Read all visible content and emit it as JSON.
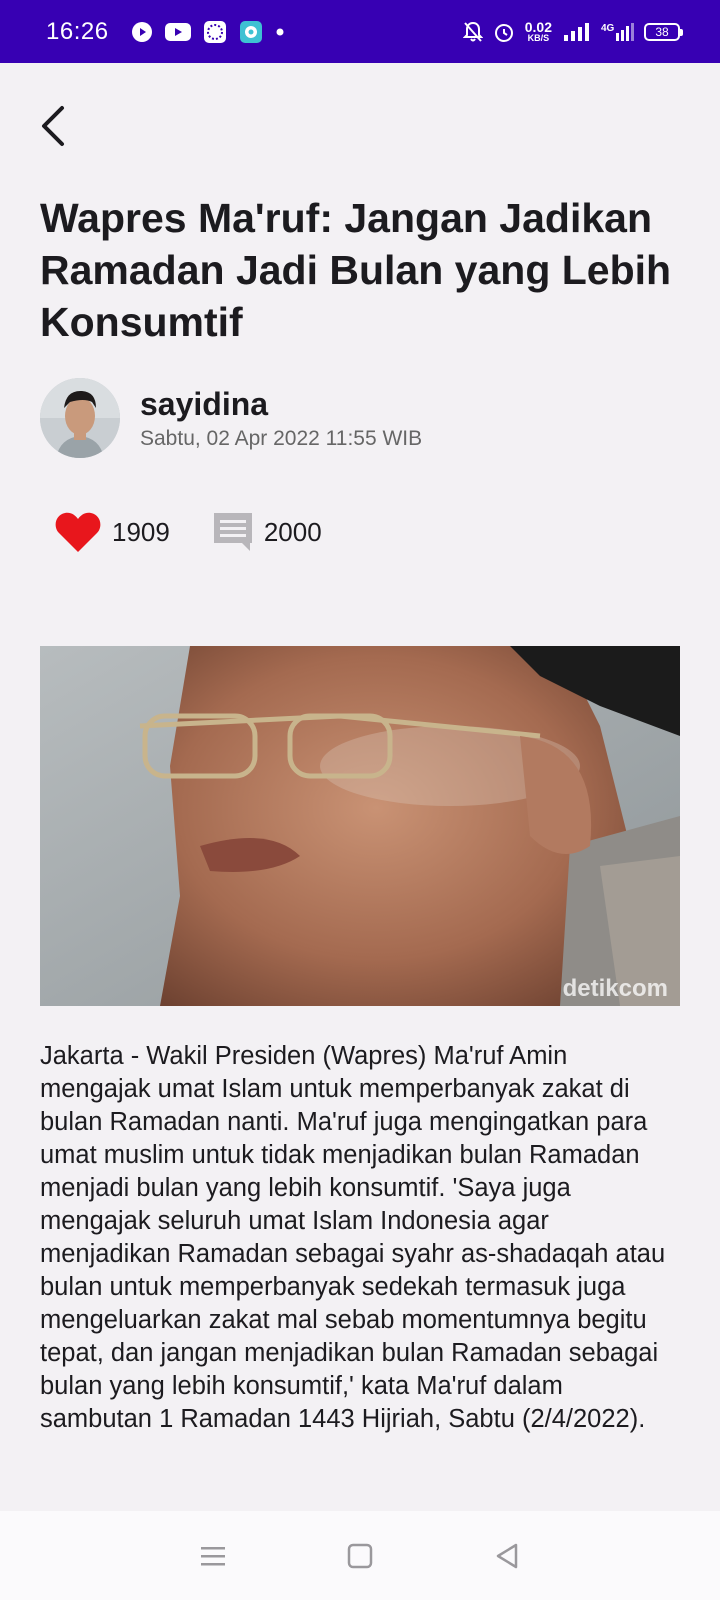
{
  "status_bar": {
    "time": "16:26",
    "net_speed_value": "0.02",
    "net_speed_unit": "KB/S",
    "network_type": "4G",
    "battery": "38"
  },
  "article": {
    "title": "Wapres Ma'ruf: Jangan Jadikan Ramadan Jadi Bulan yang Lebih Konsumtif",
    "author": "sayidina",
    "date": "Sabtu, 02 Apr 2022 11:55 WIB",
    "likes": "1909",
    "comments": "2000",
    "image_watermark": "detikcom",
    "body": "Jakarta - Wakil Presiden (Wapres) Ma'ruf Amin mengajak umat Islam untuk memperbanyak zakat di bulan Ramadan nanti. Ma'ruf juga mengingatkan para umat muslim untuk tidak menjadikan bulan Ramadan menjadi bulan yang lebih konsumtif. 'Saya juga mengajak seluruh umat Islam Indonesia agar menjadikan Ramadan sebagai syahr as-shadaqah atau bulan untuk memperbanyak sedekah termasuk juga mengeluarkan zakat mal sebab momentumnya begitu tepat, dan jangan menjadikan bulan Ramadan sebagai bulan yang lebih konsumtif,' kata Ma'ruf dalam sambutan 1 Ramadan 1443 Hijriah, Sabtu (2/4/2022)."
  },
  "icons": {
    "back": "back-arrow-icon",
    "like": "heart-icon",
    "comment": "comment-icon",
    "nav_menu": "menu-icon",
    "nav_home": "home-icon",
    "nav_back": "nav-back-icon"
  },
  "colors": {
    "status_bar": "#3700b3",
    "like": "#e8161c",
    "comment": "#b8b6ba",
    "background": "#f3f1f4"
  }
}
